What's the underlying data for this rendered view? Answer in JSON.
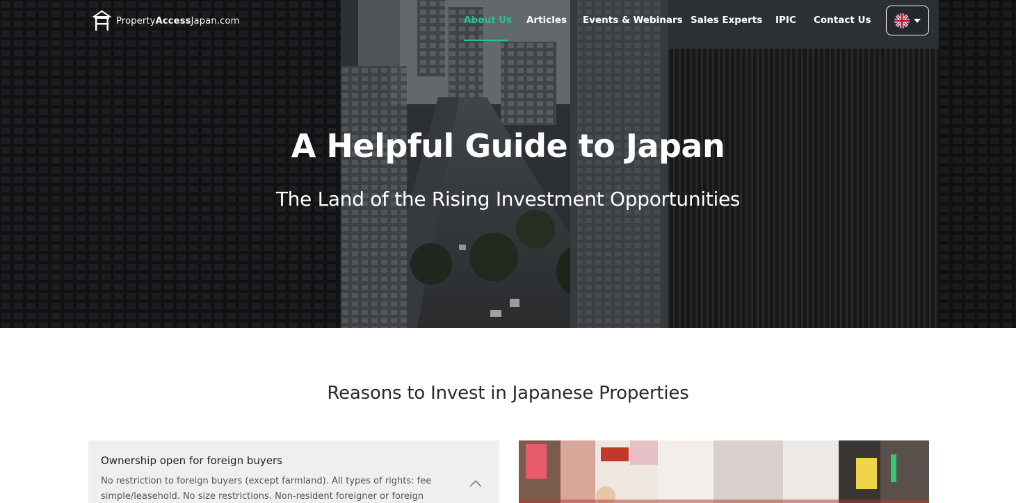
{
  "logo": {
    "part1": "Property",
    "part2": "Access",
    "part3": "Japan",
    "part4": ".com"
  },
  "nav": {
    "items": [
      {
        "label": "About Us",
        "active": true
      },
      {
        "label": "Articles"
      },
      {
        "label": "Events & Webinars"
      },
      {
        "label": "Sales Experts"
      },
      {
        "label": "IPIC"
      },
      {
        "label": "Contact Us"
      }
    ],
    "accent_color": "#27c28a",
    "language_icon": "uk-flag-icon"
  },
  "hero": {
    "title": "A Helpful Guide to Japan",
    "subtitle": "The Land of the Rising Investment Opportunities"
  },
  "reasons": {
    "title": "Reasons to Invest in Japanese Properties",
    "items": [
      {
        "question": "Ownership open for foreign buyers",
        "answer": "No restriction to foreign buyers (except farmland). All types of rights: fee simple/leasehold. No size restrictions. Non-resident foreigner or foreign"
      }
    ]
  }
}
